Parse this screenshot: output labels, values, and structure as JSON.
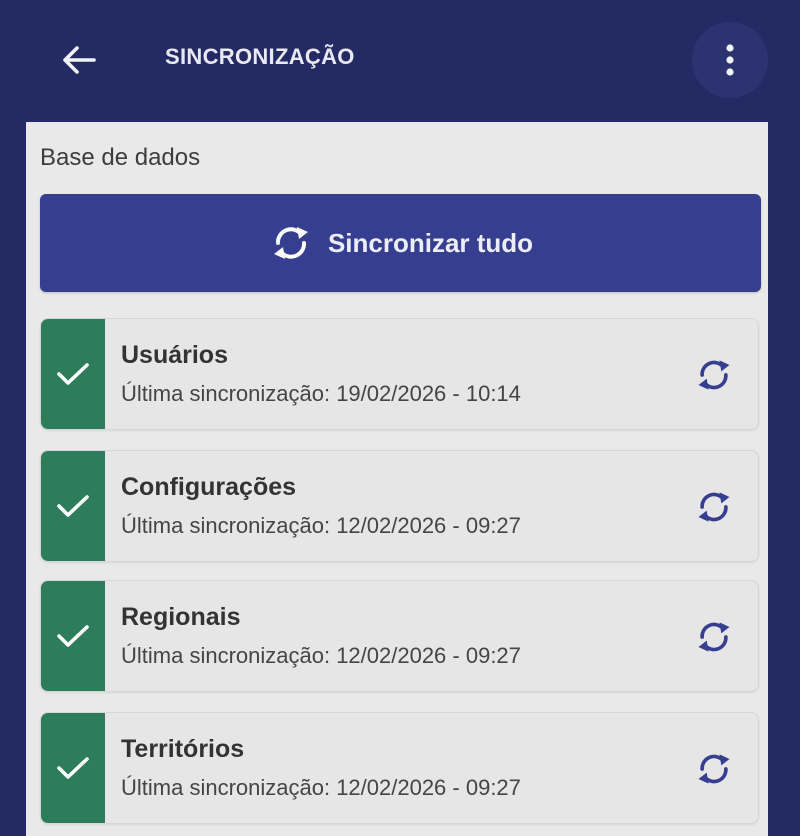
{
  "header": {
    "title": "SINCRONIZAÇÃO",
    "back_icon": "arrow-left-icon",
    "menu_icon": "more-vertical-icon"
  },
  "section": {
    "title": "Base de dados"
  },
  "sync_all": {
    "label": "Sincronizar tudo",
    "icon": "sync-icon"
  },
  "items": [
    {
      "name": "Usuários",
      "last_sync": "Última sincronização: 19/02/2026 - 10:14"
    },
    {
      "name": "Configurações",
      "last_sync": "Última sincronização: 12/02/2026 - 09:27"
    },
    {
      "name": "Regionais",
      "last_sync": "Última sincronização: 12/02/2026 - 09:27"
    },
    {
      "name": "Territórios",
      "last_sync": "Última sincronização: 12/02/2026 - 09:27"
    }
  ],
  "colors": {
    "header_bg": "#242a63",
    "primary_button": "#363e8f",
    "status_ok": "#2e7d5a",
    "panel_bg": "#e9e9ea"
  }
}
